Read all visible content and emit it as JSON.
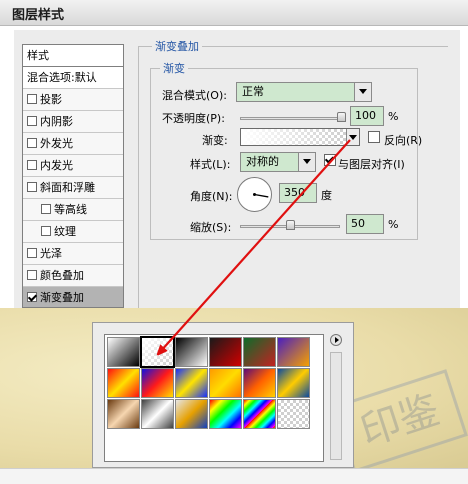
{
  "window": {
    "title": "图层样式"
  },
  "style_list": {
    "header": "样式",
    "items": [
      {
        "label": "混合选项:默认",
        "checkbox": false,
        "checked": false,
        "indent": false,
        "selected": false
      },
      {
        "label": "投影",
        "checkbox": true,
        "checked": false,
        "indent": false,
        "selected": false
      },
      {
        "label": "内阴影",
        "checkbox": true,
        "checked": false,
        "indent": false,
        "selected": false
      },
      {
        "label": "外发光",
        "checkbox": true,
        "checked": false,
        "indent": false,
        "selected": false
      },
      {
        "label": "内发光",
        "checkbox": true,
        "checked": false,
        "indent": false,
        "selected": false
      },
      {
        "label": "斜面和浮雕",
        "checkbox": true,
        "checked": false,
        "indent": false,
        "selected": false
      },
      {
        "label": "等高线",
        "checkbox": true,
        "checked": false,
        "indent": true,
        "selected": false
      },
      {
        "label": "纹理",
        "checkbox": true,
        "checked": false,
        "indent": true,
        "selected": false
      },
      {
        "label": "光泽",
        "checkbox": true,
        "checked": false,
        "indent": false,
        "selected": false
      },
      {
        "label": "颜色叠加",
        "checkbox": true,
        "checked": false,
        "indent": false,
        "selected": false
      },
      {
        "label": "渐变叠加",
        "checkbox": true,
        "checked": true,
        "indent": false,
        "selected": true
      }
    ]
  },
  "panel": {
    "group_title": "渐变叠加",
    "subgroup_title": "渐变",
    "blend_mode_label": "混合模式(O):",
    "blend_mode_value": "正常",
    "opacity_label": "不透明度(P):",
    "opacity_value": "100",
    "opacity_unit": "%",
    "opacity_level": 1.0,
    "gradient_label": "渐变:",
    "reverse_label": "反向(R)",
    "reverse_checked": false,
    "style_label": "样式(L):",
    "style_value": "对称的",
    "align_label": "与图层对齐(I)",
    "align_checked": true,
    "angle_label": "角度(N):",
    "angle_value": "350",
    "angle_unit": "度",
    "scale_label": "缩放(S):",
    "scale_value": "50",
    "scale_unit": "%",
    "scale_level": 0.5
  },
  "gradient_picker": {
    "menu_icon": "triangle-right-icon",
    "selected_index": 1,
    "presets": [
      "linear-gradient(135deg,#ffffff,#000000)",
      "checker-fade",
      "linear-gradient(135deg,#000000,#ffffff)",
      "linear-gradient(135deg,#1a1a1a,#d10000)",
      "linear-gradient(135deg,#0d6b2a,#c22222)",
      "linear-gradient(135deg,#4a1fbf,#f6a000)",
      "linear-gradient(135deg,#ff1010,#ffe000,#ff1010)",
      "linear-gradient(135deg,#1010e0,#ff1a1a,#ffe000)",
      "linear-gradient(135deg,#1530ff,#ffe400,#1530ff)",
      "linear-gradient(135deg,#ff9a00,#ffdc00,#ff7000)",
      "linear-gradient(135deg,#5a0a78,#ff6000,#ffd000)",
      "linear-gradient(135deg,#0a4aa0,#ffcc00,#0a4aa0)",
      "linear-gradient(135deg,#6a3a10,#f6d6b0,#6a3a10)",
      "linear-gradient(135deg,#404040,#ffffff,#404040)",
      "linear-gradient(135deg,#e6e6e6,#e6a000,#1040c0)",
      "linear-gradient(135deg,#ff0000,#ffff00,#00ff00,#00ffff,#0000ff,#ff00ff)",
      "repeating-linear-gradient(135deg,#ff0000 0px,#ffff00 4px,#00ff00 8px,#00ffff 12px,#0000ff 16px,#ff00ff 20px)",
      "checker"
    ]
  }
}
